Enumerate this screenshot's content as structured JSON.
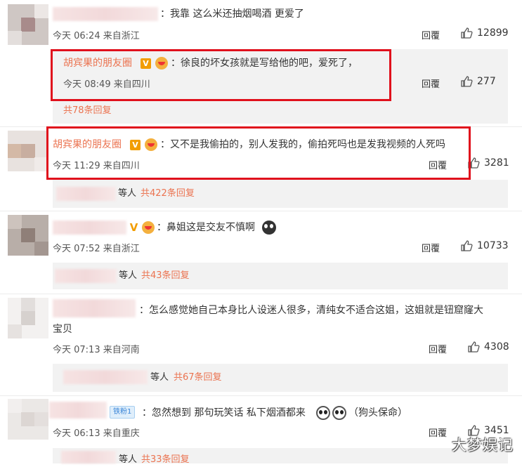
{
  "comments": [
    {
      "text": "：我靠 这么米还抽烟喝酒 更爱了",
      "meta": "今天 06:24 来自浙江",
      "reply": "回覆",
      "likes": "12899"
    },
    {
      "text": "：又不是我偷拍的，别人发我的，偷拍死吗也是发我视频的人死吗",
      "author": "胡宾果的朋友圈",
      "meta": "今天 11:29 来自四川",
      "reply": "回覆",
      "likes": "3281"
    },
    {
      "text": "：鼻姐这是交友不慎啊",
      "meta": "今天 07:52 来自浙江",
      "reply": "回覆",
      "likes": "10733"
    },
    {
      "text": "：怎么感觉她自己本身比人设迷人很多，清纯女不适合这姐，这姐就是钮窟窿大",
      "text2": "宝贝",
      "meta": "今天 07:13 来自河南",
      "reply": "回覆",
      "likes": "4308"
    },
    {
      "text": "：忽然想到 那句玩笑话 私下烟酒都来",
      "text_tail": "（狗头保命）",
      "fan_badge": "铁粉1",
      "meta": "今天 06:13 来自重庆",
      "reply": "回覆",
      "likes": "3451"
    }
  ],
  "reply1": {
    "author": "胡宾果的朋友圈",
    "text": "：徐良的坏女孩就是写给他的吧，爱死了，",
    "meta": "今天 08:49 来自四川",
    "reply": "回覆",
    "likes": "277"
  },
  "more": {
    "c1": "共78条回复",
    "c2_prefix": "等人",
    "c2": "共422条回复",
    "c3_prefix": "等人",
    "c3": "共43条回复",
    "c4_prefix": "等人",
    "c4": "共67条回复",
    "c5_prefix": "等人",
    "c5": "共33条回复"
  },
  "watermark": "大梦娱记",
  "colors": {
    "orange": "#eb7350",
    "highlight": "#e0101c",
    "subbg": "#f2f2f2"
  }
}
